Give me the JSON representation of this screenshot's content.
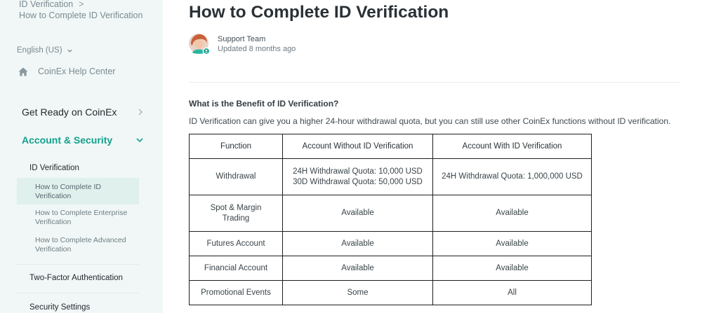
{
  "breadcrumb": {
    "parent": "ID Verification",
    "separator": ">",
    "current": "How to Complete ID Verification"
  },
  "language": {
    "label": "English (US)",
    "icon": "chevron-down-icon"
  },
  "help_center": {
    "label": "CoinEx Help Center",
    "icon": "home-icon"
  },
  "nav": {
    "get_ready": "Get Ready on CoinEx",
    "account_security": "Account & Security",
    "section": "ID Verification",
    "items": [
      {
        "label": "How to Complete ID Verification",
        "active": true
      },
      {
        "label": "How to Complete Enterprise Verification",
        "active": false
      },
      {
        "label": "How to Complete Advanced Verification",
        "active": false
      }
    ],
    "two_factor": "Two-Factor Authentication",
    "security_settings": "Security Settings"
  },
  "article": {
    "title": "How to Complete ID Verification",
    "author": "Support Team",
    "updated": "Updated 8 months ago",
    "section_heading": "What is the Benefit of ID Verification?",
    "intro": "ID Verification can give you a higher 24-hour withdrawal quota, but you can still use other CoinEx functions without ID verification."
  },
  "table": {
    "headers": [
      "Function",
      "Account Without ID Verification",
      "Account With ID Verification"
    ],
    "rows": [
      [
        "Withdrawal",
        "24H Withdrawal Quota: 10,000 USD\n30D Withdrawal Quota: 50,000 USD",
        "24H Withdrawal Quota: 1,000,000 USD"
      ],
      [
        "Spot & Margin Trading",
        "Available",
        "Available"
      ],
      [
        "Futures Account",
        "Available",
        "Available"
      ],
      [
        "Financial Account",
        "Available",
        "Available"
      ],
      [
        "Promotional Events",
        "Some",
        "All"
      ]
    ]
  },
  "colors": {
    "accent": "#12a08c",
    "sidebar_bg": "#f1f7f7",
    "active_item_bg": "#dff0ed"
  }
}
